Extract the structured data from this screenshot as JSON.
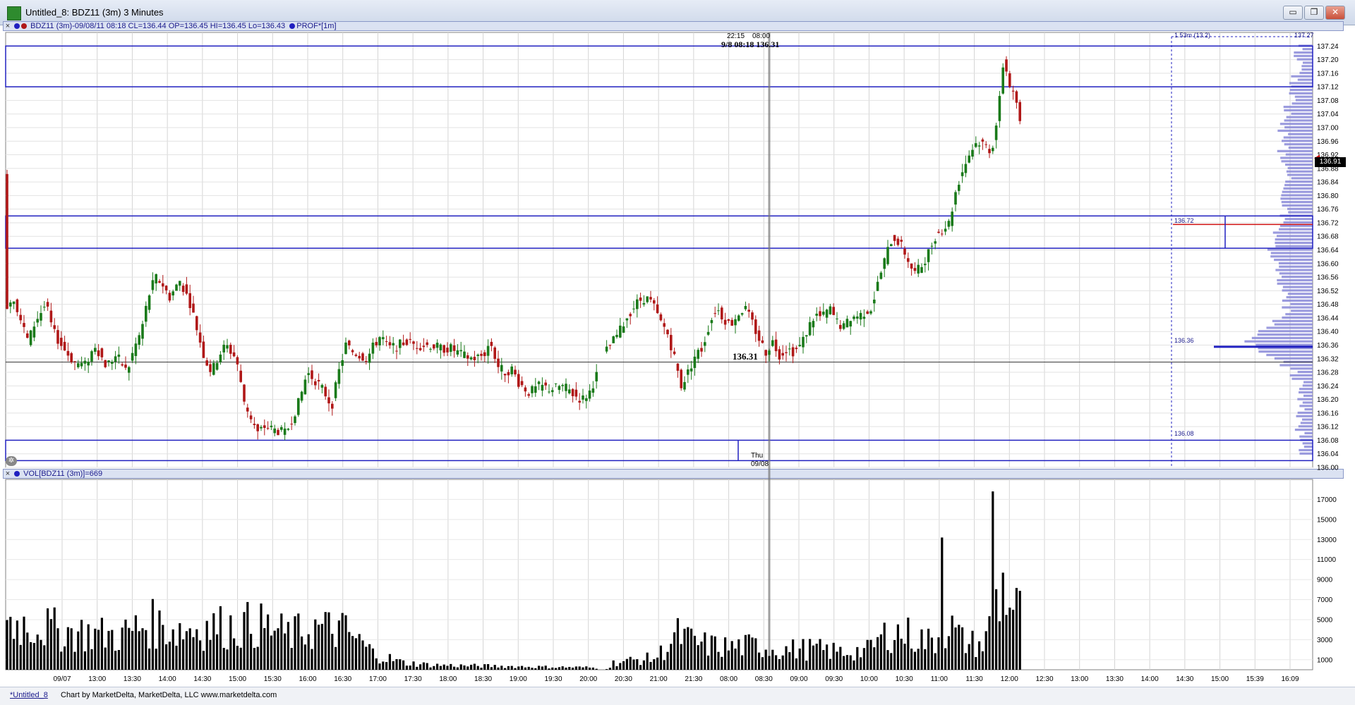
{
  "window": {
    "title": "Untitled_8: BDZ11 (3m) 3 Minutes",
    "minimize_glyph": "▭",
    "restore_glyph": "❐",
    "close_glyph": "✕"
  },
  "price_pane": {
    "header_text": "BDZ11 (3m)-09/08/11 08:18 CL=136.44 OP=136.45 HI=136.45 Lo=136.43",
    "study_label": "PROF*[1m]",
    "crosshair_time": "22:15",
    "crosshair_time2": "08:00",
    "crosshair_readout": "9/8 08:18 136.31",
    "price_marker_label": "136.31",
    "day_label_1": "Thu",
    "day_label_2": "09/08",
    "profile_header": "1.53m (13.2)",
    "profile_high": "137.27",
    "current_price": "136.91",
    "level_labels": [
      "136.72",
      "136.36",
      "136.08"
    ]
  },
  "volume_pane": {
    "header_text": "VOL[BDZ11 (3m)]=669"
  },
  "footer": {
    "tab": "*Untitled_8",
    "credit": "Chart by MarketDelta, MarketDelta, LLC www.marketdelta.com"
  },
  "colors": {
    "up": "#1a7a1a",
    "down": "#b01818",
    "frame": "#2020c0",
    "profile": "#8a8ad8",
    "volume": "#000000"
  },
  "chart_data": [
    {
      "type": "candlestick",
      "symbol": "BDZ11",
      "ylim": [
        136.0,
        137.28
      ],
      "y_ticks": [
        137.24,
        137.2,
        137.16,
        137.12,
        137.08,
        137.04,
        137.0,
        136.96,
        136.92,
        136.88,
        136.84,
        136.8,
        136.76,
        136.72,
        136.68,
        136.64,
        136.6,
        136.56,
        136.52,
        136.48,
        136.44,
        136.4,
        136.36,
        136.32,
        136.28,
        136.24,
        136.2,
        136.16,
        136.12,
        136.08,
        136.04,
        136.0
      ],
      "x_ticks": [
        "09/07",
        "13:00",
        "13:30",
        "14:00",
        "14:30",
        "15:00",
        "15:30",
        "16:00",
        "16:30",
        "17:00",
        "17:30",
        "18:00",
        "18:30",
        "19:00",
        "19:30",
        "20:00",
        "20:30",
        "21:00",
        "21:30",
        "08:00",
        "08:30",
        "09:00",
        "09:30",
        "10:00",
        "10:30",
        "11:00",
        "11:30",
        "12:00",
        "12:30",
        "13:00",
        "13:30",
        "14:00",
        "14:30",
        "15:00",
        "15:39",
        "16:09"
      ],
      "close_path": [
        [
          0,
          136.48
        ],
        [
          10,
          136.5
        ],
        [
          20,
          136.43
        ],
        [
          30,
          136.37
        ],
        [
          40,
          136.43
        ],
        [
          55,
          136.48
        ],
        [
          65,
          136.4
        ],
        [
          80,
          136.35
        ],
        [
          95,
          136.31
        ],
        [
          110,
          136.3
        ],
        [
          125,
          136.36
        ],
        [
          140,
          136.3
        ],
        [
          155,
          136.33
        ],
        [
          170,
          136.28
        ],
        [
          180,
          136.35
        ],
        [
          190,
          136.4
        ],
        [
          200,
          136.5
        ],
        [
          210,
          136.56
        ],
        [
          220,
          136.54
        ],
        [
          230,
          136.5
        ],
        [
          245,
          136.55
        ],
        [
          260,
          136.48
        ],
        [
          270,
          136.4
        ],
        [
          280,
          136.32
        ],
        [
          290,
          136.28
        ],
        [
          300,
          136.33
        ],
        [
          310,
          136.36
        ],
        [
          325,
          136.32
        ],
        [
          335,
          136.2
        ],
        [
          345,
          136.15
        ],
        [
          355,
          136.1
        ],
        [
          365,
          136.12
        ],
        [
          380,
          136.11
        ],
        [
          395,
          136.1
        ],
        [
          405,
          136.15
        ],
        [
          415,
          136.2
        ],
        [
          425,
          136.28
        ],
        [
          440,
          136.25
        ],
        [
          450,
          136.22
        ],
        [
          460,
          136.18
        ],
        [
          470,
          136.28
        ],
        [
          480,
          136.36
        ],
        [
          490,
          136.34
        ],
        [
          500,
          136.33
        ],
        [
          510,
          136.32
        ],
        [
          520,
          136.36
        ],
        [
          530,
          136.39
        ],
        [
          540,
          136.35
        ],
        [
          555,
          136.36
        ],
        [
          565,
          136.37
        ],
        [
          580,
          136.36
        ],
        [
          600,
          136.36
        ],
        [
          615,
          136.35
        ],
        [
          630,
          136.35
        ],
        [
          645,
          136.33
        ],
        [
          660,
          136.32
        ],
        [
          675,
          136.33
        ],
        [
          685,
          136.37
        ],
        [
          695,
          136.3
        ],
        [
          705,
          136.28
        ],
        [
          715,
          136.29
        ],
        [
          725,
          136.25
        ],
        [
          740,
          136.22
        ],
        [
          755,
          136.24
        ],
        [
          770,
          136.23
        ],
        [
          785,
          136.24
        ],
        [
          795,
          136.23
        ],
        [
          805,
          136.21
        ],
        [
          815,
          136.2
        ],
        [
          825,
          136.22
        ],
        [
          835,
          136.27
        ],
        [
          845,
          136.33
        ],
        [
          855,
          136.36
        ],
        [
          868,
          136.4
        ],
        [
          880,
          136.45
        ],
        [
          895,
          136.49
        ],
        [
          905,
          136.5
        ],
        [
          915,
          136.48
        ],
        [
          925,
          136.43
        ],
        [
          935,
          136.4
        ],
        [
          945,
          136.33
        ],
        [
          955,
          136.24
        ],
        [
          965,
          136.28
        ],
        [
          975,
          136.33
        ],
        [
          985,
          136.35
        ],
        [
          995,
          136.42
        ],
        [
          1005,
          136.47
        ],
        [
          1015,
          136.44
        ],
        [
          1025,
          136.42
        ],
        [
          1035,
          136.45
        ],
        [
          1045,
          136.47
        ],
        [
          1055,
          136.43
        ],
        [
          1065,
          136.38
        ],
        [
          1075,
          136.34
        ],
        [
          1085,
          136.37
        ],
        [
          1095,
          136.33
        ],
        [
          1105,
          136.35
        ],
        [
          1115,
          136.34
        ],
        [
          1125,
          136.36
        ],
        [
          1135,
          136.41
        ],
        [
          1145,
          136.45
        ],
        [
          1155,
          136.44
        ],
        [
          1165,
          136.47
        ],
        [
          1175,
          136.43
        ],
        [
          1185,
          136.41
        ],
        [
          1195,
          136.44
        ],
        [
          1210,
          136.45
        ],
        [
          1225,
          136.47
        ],
        [
          1235,
          136.55
        ],
        [
          1245,
          136.62
        ],
        [
          1255,
          136.68
        ],
        [
          1265,
          136.66
        ],
        [
          1275,
          136.62
        ],
        [
          1285,
          136.57
        ],
        [
          1295,
          136.59
        ],
        [
          1305,
          136.63
        ],
        [
          1315,
          136.68
        ],
        [
          1325,
          136.7
        ],
        [
          1335,
          136.72
        ],
        [
          1345,
          136.82
        ],
        [
          1355,
          136.88
        ],
        [
          1365,
          136.93
        ],
        [
          1375,
          136.96
        ],
        [
          1385,
          136.95
        ],
        [
          1395,
          136.93
        ],
        [
          1405,
          137.05
        ],
        [
          1412,
          137.2
        ],
        [
          1418,
          137.15
        ],
        [
          1424,
          137.1
        ],
        [
          1430,
          137.08
        ],
        [
          1436,
          137.0
        ],
        [
          1441,
          136.9
        ],
        [
          1446,
          136.87
        ]
      ],
      "horizontal_lines": [
        137.12,
        136.74,
        136.645,
        136.08,
        136.02,
        136.31
      ]
    },
    {
      "type": "bar",
      "series_label": "VOL[BDZ11 (3m)]",
      "ylim": [
        0,
        19000
      ],
      "y_ticks": [
        17000,
        15000,
        13000,
        11000,
        9000,
        7000,
        5000,
        3000,
        1000
      ],
      "volume_path": [
        [
          0,
          6000
        ],
        [
          40,
          5500
        ],
        [
          80,
          4800
        ],
        [
          120,
          4500
        ],
        [
          160,
          4200
        ],
        [
          200,
          5800
        ],
        [
          240,
          5000
        ],
        [
          280,
          5300
        ],
        [
          320,
          5400
        ],
        [
          355,
          5600
        ],
        [
          400,
          4300
        ],
        [
          440,
          5200
        ],
        [
          480,
          4800
        ],
        [
          520,
          2000
        ],
        [
          560,
          900
        ],
        [
          600,
          600
        ],
        [
          650,
          500
        ],
        [
          700,
          450
        ],
        [
          760,
          350
        ],
        [
          820,
          300
        ],
        [
          850,
          150
        ],
        [
          860,
          900
        ],
        [
          890,
          1200
        ],
        [
          920,
          1500
        ],
        [
          950,
          4300
        ],
        [
          980,
          3200
        ],
        [
          1020,
          2800
        ],
        [
          1060,
          3000
        ],
        [
          1100,
          2500
        ],
        [
          1140,
          2600
        ],
        [
          1180,
          2200
        ],
        [
          1220,
          2400
        ],
        [
          1250,
          4800
        ],
        [
          1280,
          4300
        ],
        [
          1310,
          3400
        ],
        [
          1335,
          5500
        ],
        [
          1355,
          3500
        ],
        [
          1385,
          3000
        ],
        [
          1400,
          8000
        ],
        [
          1412,
          10500
        ],
        [
          1425,
          7500
        ],
        [
          1436,
          7000
        ],
        [
          1446,
          6800
        ]
      ]
    }
  ]
}
